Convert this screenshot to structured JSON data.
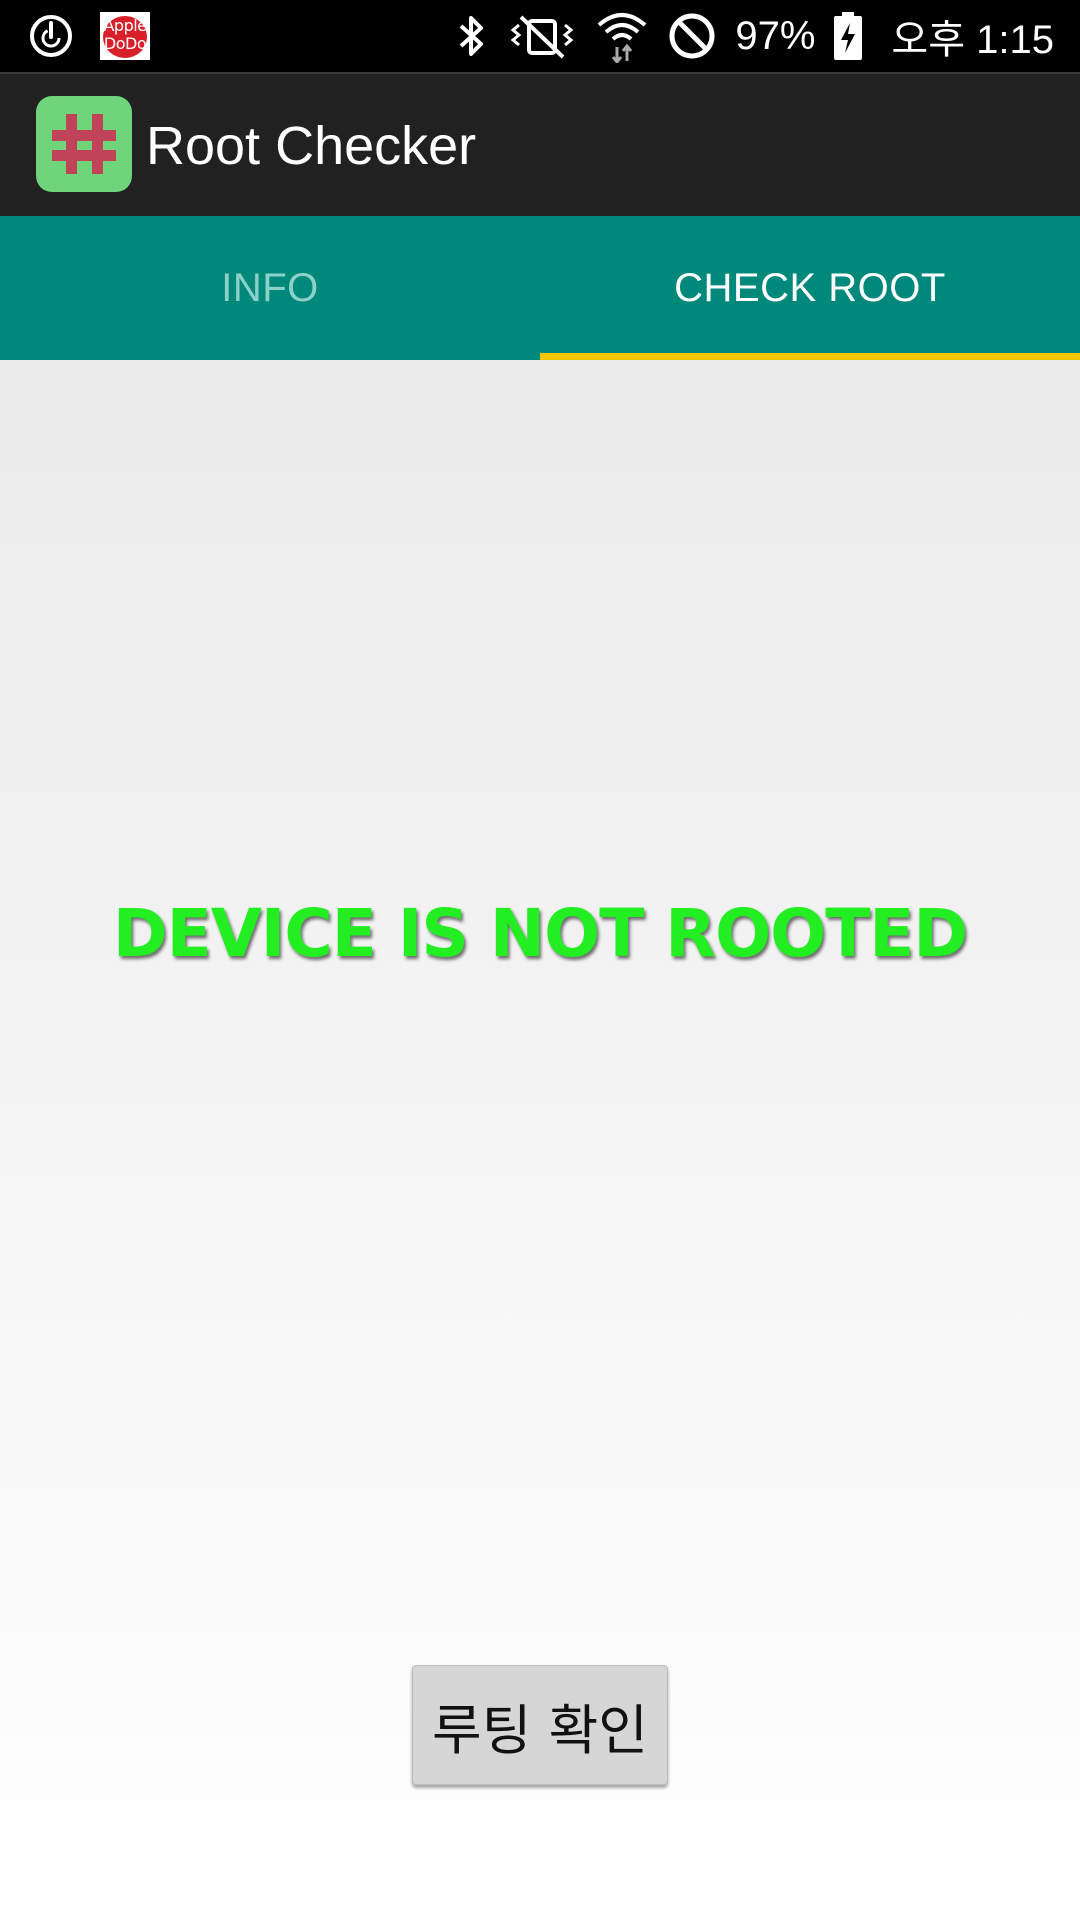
{
  "status_bar": {
    "notification_badge_text": "Apple DoDo",
    "battery": "97%",
    "time": "오후 1:15"
  },
  "app": {
    "title": "Root Checker"
  },
  "tabs": [
    {
      "label": "INFO",
      "active": false
    },
    {
      "label": "CHECK ROOT",
      "active": true
    }
  ],
  "main": {
    "status_message": "DEVICE IS NOT ROOTED",
    "status_color": "#22ee22",
    "check_button_label": "루팅 확인"
  },
  "colors": {
    "tab_bar": "#00897b",
    "tab_indicator": "#f7c600",
    "action_bar": "#212121"
  },
  "icons": [
    "power-cycle-icon",
    "apple-dodo-notification-icon",
    "bluetooth-icon",
    "vibrate-mute-icon",
    "wifi-icon",
    "do-not-disturb-icon",
    "battery-charging-icon",
    "app-hash-icon"
  ]
}
